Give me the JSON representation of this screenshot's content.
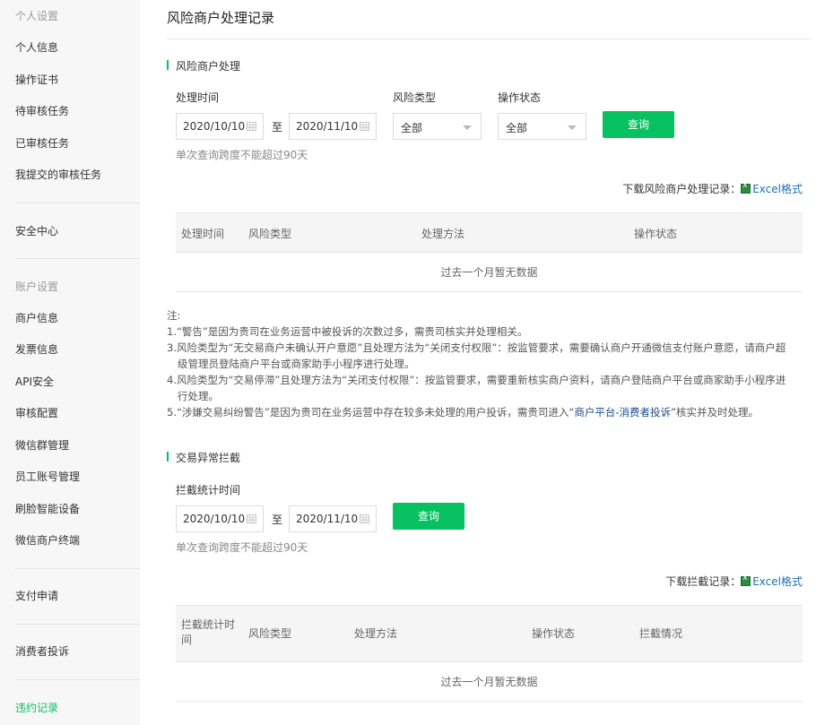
{
  "sidebar": {
    "sections": [
      {
        "title": "个人设置",
        "items": [
          "个人信息",
          "操作证书",
          "待审核任务",
          "已审核任务",
          "我提交的审核任务"
        ]
      },
      {
        "items": [
          "安全中心"
        ]
      },
      {
        "title": "账户设置",
        "items": [
          "商户信息",
          "发票信息",
          "API安全",
          "审核配置",
          "微信群管理",
          "员工账号管理",
          "刷脸智能设备",
          "微信商户终端"
        ]
      },
      {
        "items": [
          "支付申请"
        ]
      },
      {
        "items": [
          "消费者投诉"
        ]
      },
      {
        "items": [
          "违约记录"
        ]
      }
    ],
    "active": "违约记录"
  },
  "page": {
    "title": "风险商户处理记录"
  },
  "risk": {
    "section_title": "风险商户处理",
    "time_label": "处理时间",
    "start_date": "2020/10/10",
    "to": "至",
    "end_date": "2020/11/10",
    "type_label": "风险类型",
    "type_value": "全部",
    "status_label": "操作状态",
    "status_value": "全部",
    "query": "查询",
    "hint": "单次查询跨度不能超过90天",
    "download_prefix": "下载风险商户处理记录：",
    "download_link": "Excel格式",
    "columns": [
      "处理时间",
      "风险类型",
      "处理方法",
      "操作状态"
    ],
    "empty": "过去一个月暂无数据"
  },
  "notes": {
    "title": "注:",
    "n1": "1.“警告”是因为贵司在业务运营中被投诉的次数过多，需贵司核实并处理相关。",
    "n3a": "3.风险类型为“无交易商户未确认开户意愿”且处理方法为“关闭支付权限”：按监管要求，需要确认商户开通微信支付账户意愿，请商户超",
    "n3b": "级管理员登陆商户平台或商家助手小程序进行处理。",
    "n4a": "4.风险类型为“交易停滞”且处理方法为“关闭支付权限”：按监管要求，需要重新核实商户资料，请商户登陆商户平台或商家助手小程序进",
    "n4b": "行处理。",
    "n5a": "5.“涉嫌交易纠纷警告”是因为贵司在业务运营中存在较多未处理的用户投诉，需贵司进入",
    "n5link": "“商户平台-消费者投诉”",
    "n5b": "核实并及时处理。"
  },
  "intercept": {
    "section_title": "交易异常拦截",
    "time_label": "拦截统计时间",
    "start_date": "2020/10/10",
    "to": "至",
    "end_date": "2020/11/10",
    "query": "查询",
    "hint": "单次查询跨度不能超过90天",
    "download_prefix": "下载拦截记录：",
    "download_link": "Excel格式",
    "columns": [
      "拦截统计时间",
      "风险类型",
      "处理方法",
      "操作状态",
      "拦截情况"
    ],
    "col0_line1": "拦截统计时",
    "col0_line2": "间",
    "empty": "过去一个月暂无数据"
  },
  "colors": {
    "accent": "#07c160",
    "link": "#1d6fb8"
  }
}
